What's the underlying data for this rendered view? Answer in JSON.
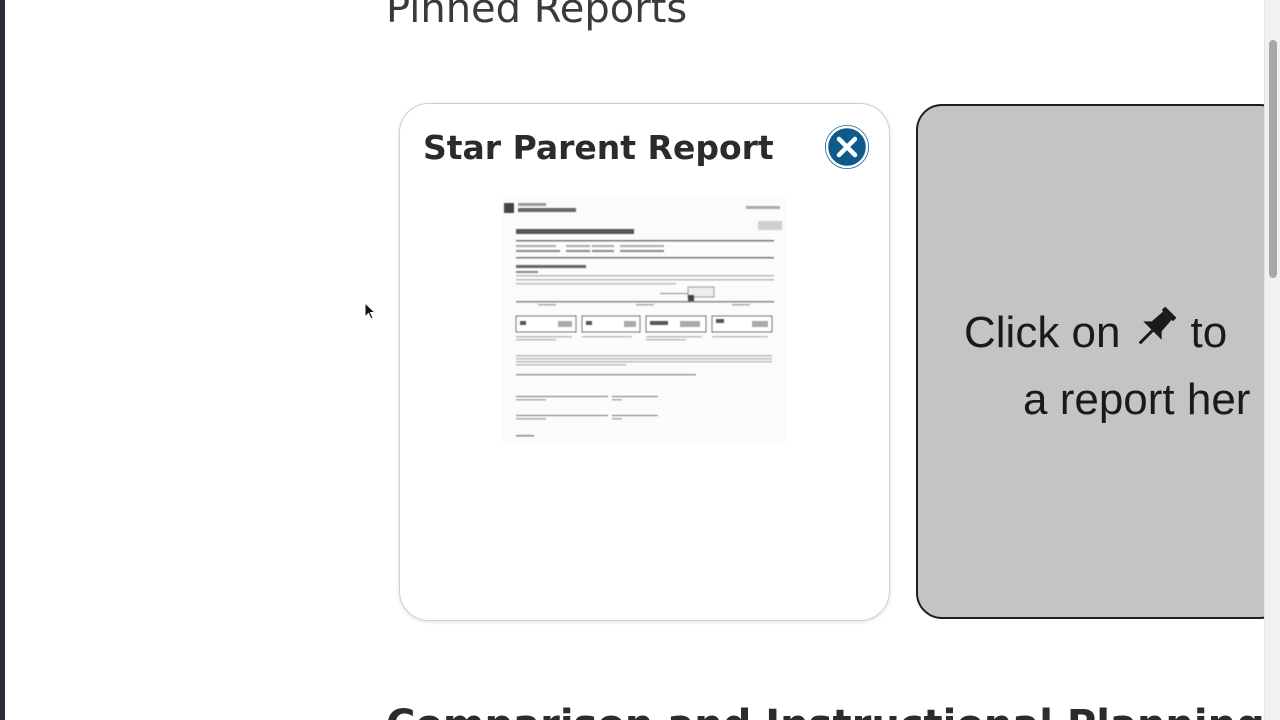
{
  "sections": {
    "pinned_title": "Pinned Reports",
    "next_title": "Comparison and Instructional Planning"
  },
  "pinned_card": {
    "title": "Star Parent Report",
    "close_icon": "close-circle-icon",
    "accent_color": "#0f5a8a"
  },
  "placeholder": {
    "line1_before": "Click on",
    "pin_icon": "pin-icon",
    "line1_after": "to",
    "line2": "a report her",
    "background": "#c4c4c4"
  }
}
